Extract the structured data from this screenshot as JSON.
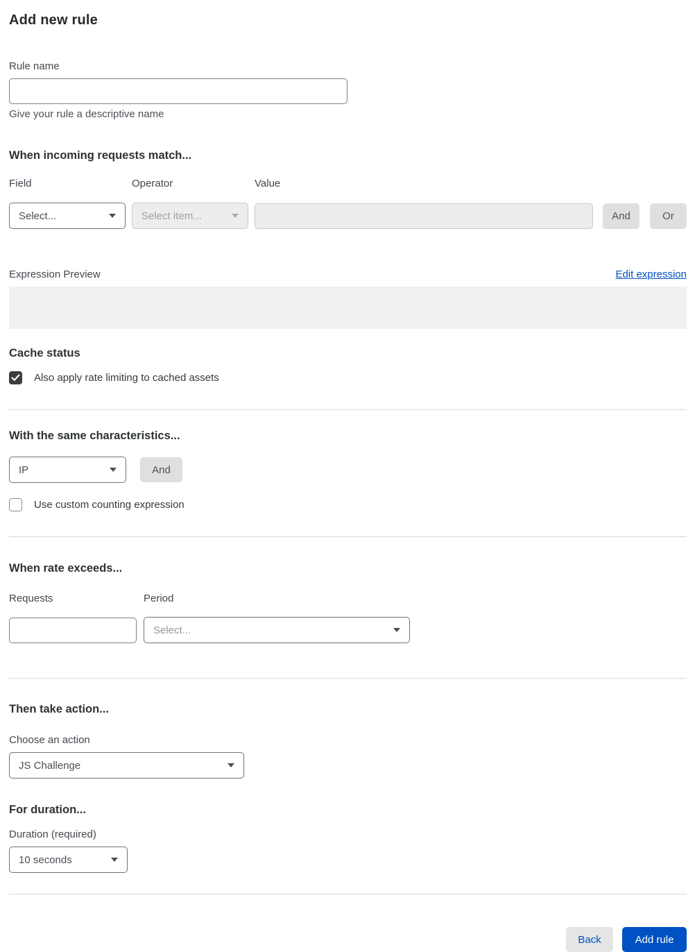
{
  "page": {
    "title": "Add new rule"
  },
  "rule_name": {
    "label": "Rule name",
    "value": "",
    "helper": "Give your rule a descriptive name"
  },
  "match": {
    "heading": "When incoming requests match...",
    "field": {
      "label": "Field",
      "value": "Select..."
    },
    "operator": {
      "label": "Operator",
      "value": "Select item...",
      "disabled": true
    },
    "value": {
      "label": "Value",
      "value": "",
      "disabled": true
    },
    "and_label": "And",
    "or_label": "Or"
  },
  "expression": {
    "label": "Expression Preview",
    "edit_link": "Edit expression",
    "value": ""
  },
  "cache": {
    "heading": "Cache status",
    "checkbox_label": "Also apply rate limiting to cached assets",
    "checked": true
  },
  "characteristics": {
    "heading": "With the same characteristics...",
    "select_value": "IP",
    "and_label": "And",
    "checkbox_label": "Use custom counting expression",
    "checked": false
  },
  "rate": {
    "heading": "When rate exceeds...",
    "requests": {
      "label": "Requests",
      "value": ""
    },
    "period": {
      "label": "Period",
      "value": "Select..."
    }
  },
  "action": {
    "heading": "Then take action...",
    "label": "Choose an action",
    "value": "JS Challenge"
  },
  "duration": {
    "heading": "For duration...",
    "label": "Duration (required)",
    "value": "10 seconds"
  },
  "footer": {
    "back_label": "Back",
    "add_label": "Add rule"
  },
  "colors": {
    "primary_blue": "#0051c3",
    "link_blue": "#0051c3",
    "checkbox_dark": "#3d3d3d",
    "disabled_bg": "#ededed"
  }
}
